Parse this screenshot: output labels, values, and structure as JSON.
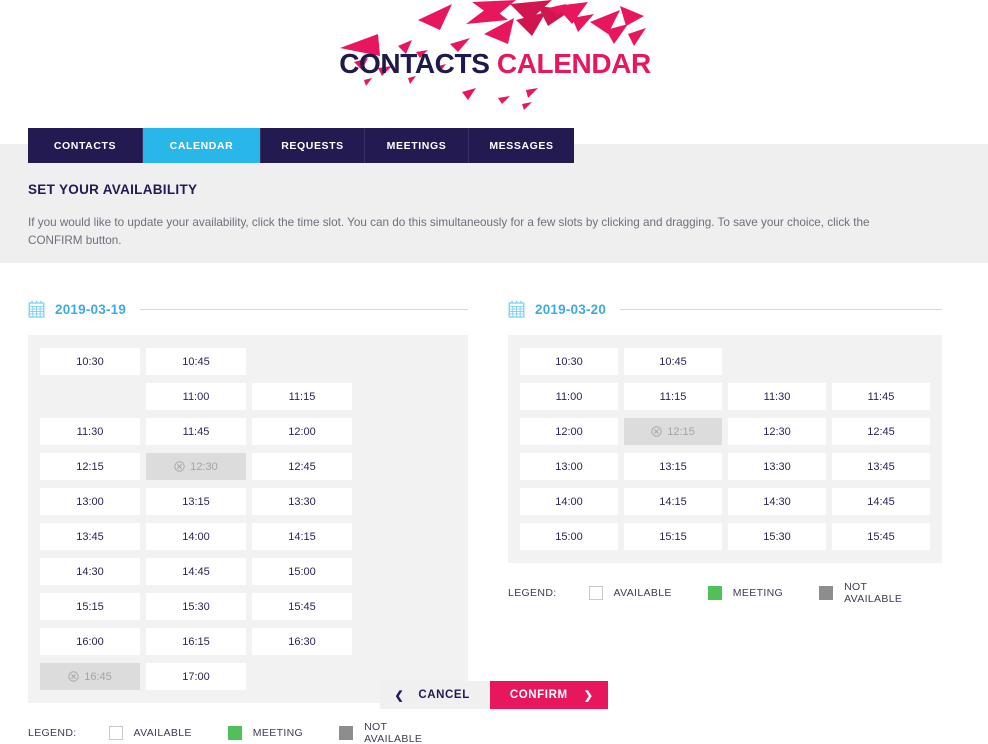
{
  "brand": {
    "logo_part1": "CONTACTS",
    "logo_part2": "CALENDAR",
    "navy": "#231a52",
    "pink": "#e8175d",
    "cyan": "#29b6e8",
    "date_blue": "#3eaae4"
  },
  "nav": {
    "tabs": [
      {
        "label": "CONTACTS",
        "active": false
      },
      {
        "label": "CALENDAR",
        "active": true
      },
      {
        "label": "REQUESTS",
        "active": false
      },
      {
        "label": "MEETINGS",
        "active": false
      },
      {
        "label": "MESSAGES",
        "active": false
      }
    ]
  },
  "section": {
    "title": "SET YOUR AVAILABILITY",
    "description": "If you would like to update your availability, click the time slot. You can do this simultaneously for a few slots by clicking and dragging. To save your choice, click the CONFIRM button."
  },
  "calendars": [
    {
      "date": "2019-03-19",
      "icon": "calendar-icon",
      "slots": [
        {
          "time": "10:30",
          "state": "available"
        },
        {
          "time": "10:45",
          "state": "available"
        },
        {
          "time": "11:00",
          "state": "available"
        },
        {
          "time": "11:15",
          "state": "available"
        },
        {
          "time": "11:30",
          "state": "available"
        },
        {
          "time": "11:45",
          "state": "available"
        },
        {
          "time": "12:00",
          "state": "available"
        },
        {
          "time": "12:15",
          "state": "available"
        },
        {
          "time": "12:30",
          "state": "not-available"
        },
        {
          "time": "12:45",
          "state": "available"
        },
        {
          "time": "13:00",
          "state": "available"
        },
        {
          "time": "13:15",
          "state": "available"
        },
        {
          "time": "13:30",
          "state": "available"
        },
        {
          "time": "13:45",
          "state": "available"
        },
        {
          "time": "14:00",
          "state": "available"
        },
        {
          "time": "14:15",
          "state": "available"
        },
        {
          "time": "14:30",
          "state": "available"
        },
        {
          "time": "14:45",
          "state": "available"
        },
        {
          "time": "15:00",
          "state": "available"
        },
        {
          "time": "15:15",
          "state": "available"
        },
        {
          "time": "15:30",
          "state": "available"
        },
        {
          "time": "15:45",
          "state": "available"
        },
        {
          "time": "16:00",
          "state": "available"
        },
        {
          "time": "16:15",
          "state": "available"
        },
        {
          "time": "16:30",
          "state": "available"
        },
        {
          "time": "16:45",
          "state": "not-available"
        },
        {
          "time": "17:00",
          "state": "available"
        }
      ]
    },
    {
      "date": "2019-03-20",
      "icon": "calendar-icon",
      "slots": [
        {
          "time": "10:30",
          "state": "available"
        },
        {
          "time": "10:45",
          "state": "available"
        },
        {
          "time": "11:00",
          "state": "available"
        },
        {
          "time": "11:15",
          "state": "available"
        },
        {
          "time": "11:30",
          "state": "available"
        },
        {
          "time": "11:45",
          "state": "available"
        },
        {
          "time": "12:00",
          "state": "available"
        },
        {
          "time": "12:15",
          "state": "not-available"
        },
        {
          "time": "12:30",
          "state": "available"
        },
        {
          "time": "12:45",
          "state": "available"
        },
        {
          "time": "13:00",
          "state": "available"
        },
        {
          "time": "13:15",
          "state": "available"
        },
        {
          "time": "13:30",
          "state": "available"
        },
        {
          "time": "13:45",
          "state": "available"
        },
        {
          "time": "14:00",
          "state": "available"
        },
        {
          "time": "14:15",
          "state": "available"
        },
        {
          "time": "14:30",
          "state": "available"
        },
        {
          "time": "14:45",
          "state": "available"
        },
        {
          "time": "15:00",
          "state": "available"
        },
        {
          "time": "15:15",
          "state": "available"
        },
        {
          "time": "15:30",
          "state": "available"
        },
        {
          "time": "15:45",
          "state": "available"
        }
      ]
    }
  ],
  "legend": {
    "title": "LEGEND:",
    "items": [
      {
        "label": "AVAILABLE",
        "color": "#ffffff",
        "swatch": "sw-available"
      },
      {
        "label": "MEETING",
        "color": "#52c05a",
        "swatch": "sw-meeting"
      },
      {
        "label": "NOT AVAILABLE",
        "color": "#8d8d8d",
        "swatch": "sw-notavail"
      }
    ]
  },
  "buttons": {
    "cancel_label": "CANCEL",
    "cancel_icon": "chevron-left-icon",
    "confirm_label": "CONFIRM",
    "confirm_icon": "chevron-right-icon"
  }
}
